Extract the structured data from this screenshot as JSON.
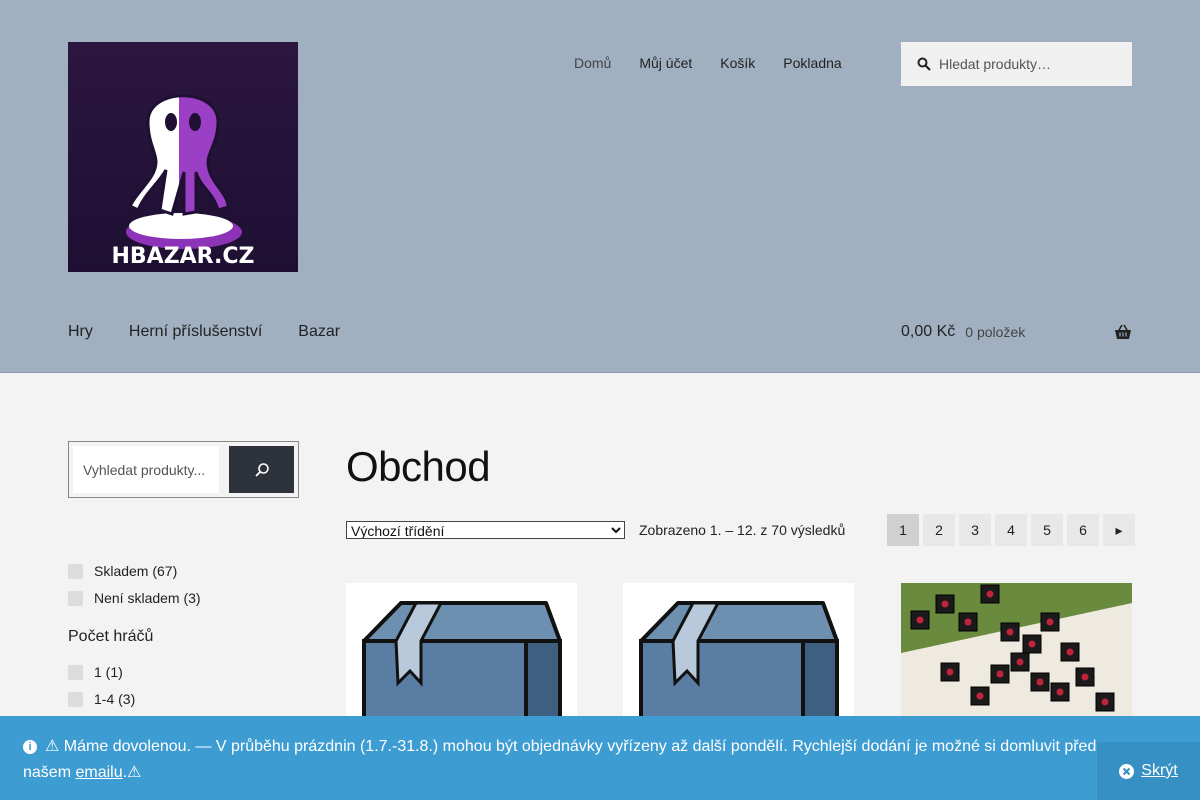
{
  "header": {
    "logo_text": "HBAZAR.CZ",
    "top_nav": [
      {
        "label": "Domů"
      },
      {
        "label": "Můj účet"
      },
      {
        "label": "Košík"
      },
      {
        "label": "Pokladna"
      }
    ],
    "search_placeholder": "Hledat produkty…",
    "main_nav": [
      {
        "label": "Hry"
      },
      {
        "label": "Herní příslušenství"
      },
      {
        "label": "Bazar"
      }
    ],
    "cart": {
      "amount": "0,00 Kč",
      "count": "0 položek"
    }
  },
  "sidebar": {
    "search_placeholder": "Vyhledat produkty...",
    "stock_filters": [
      {
        "label": "Skladem (67)"
      },
      {
        "label": "Není skladem (3)"
      }
    ],
    "players_heading": "Počet hráčů",
    "players_filters": [
      {
        "label": "1 (1)"
      },
      {
        "label": "1-4 (3)"
      }
    ]
  },
  "main": {
    "title": "Obchod",
    "sort_selected": "Výchozí třídění",
    "result_count": "Zobrazeno 1. – 12. z 70 výsledků",
    "pages": [
      "1",
      "2",
      "3",
      "4",
      "5",
      "6"
    ],
    "next_symbol": "▸"
  },
  "notice": {
    "text_before": "⚠ Máme dovolenou. — V průběhu prázdnin (1.7.-31.8.) mohou být objednávky vyřízeny až další pondělí. Rychlejší dodání je možné si domluvit předem na našem ",
    "link": "emailu",
    "text_after": ".⚠",
    "dismiss": "Skrýt"
  },
  "colors": {
    "header_bg": "#a1b0c0",
    "notice_bg": "#3d9cd2",
    "search_button": "#2e333b"
  }
}
